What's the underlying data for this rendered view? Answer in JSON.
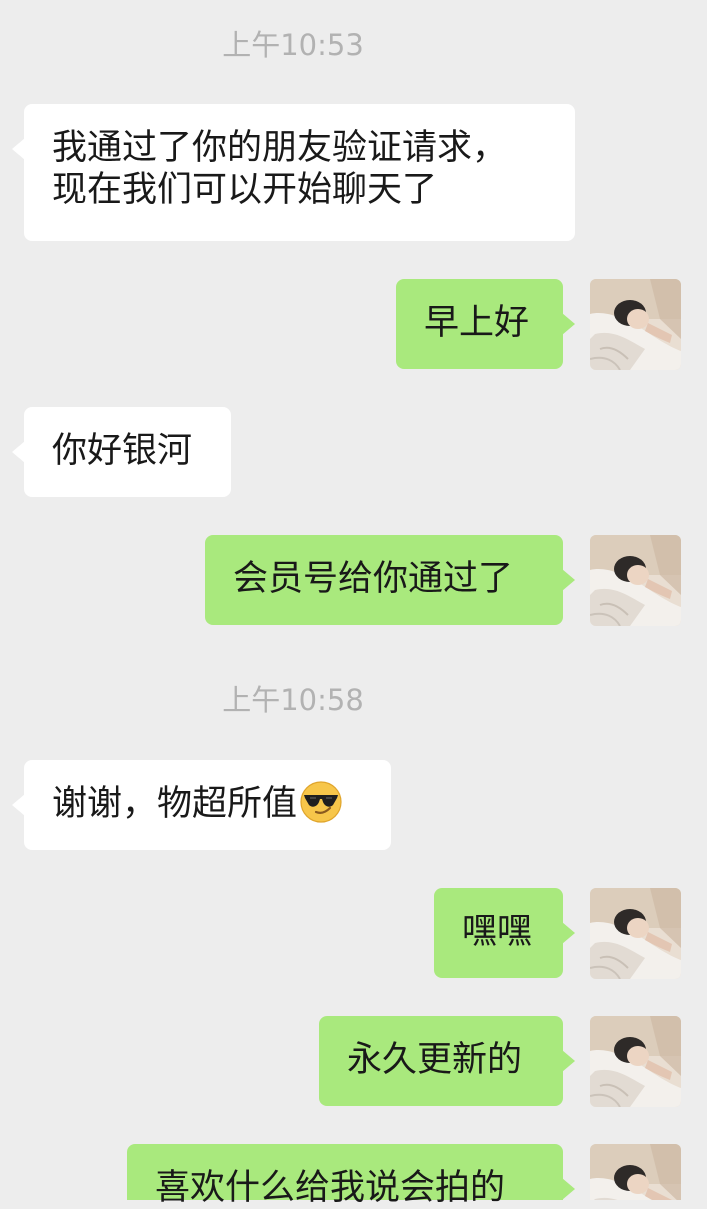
{
  "chat": {
    "messages": [
      {
        "type": "time",
        "text": "上午10:53"
      },
      {
        "type": "in",
        "lines": [
          "我通过了你的朋友验证请求，",
          "现在我们可以开始聊天了"
        ]
      },
      {
        "type": "out",
        "text": "早上好"
      },
      {
        "type": "in",
        "text": "你好银河"
      },
      {
        "type": "out",
        "text": "会员号给你通过了"
      },
      {
        "type": "time",
        "text": "上午10:58"
      },
      {
        "type": "in",
        "text": "谢谢，物超所值",
        "emoji": "smiling-face-with-sunglasses-icon"
      },
      {
        "type": "out",
        "text": "嘿嘿"
      },
      {
        "type": "out",
        "text": "永久更新的"
      },
      {
        "type": "out",
        "text": "喜欢什么给我说会拍的"
      }
    ]
  },
  "colors": {
    "background": "#ededed",
    "incoming_bubble": "#ffffff",
    "outgoing_bubble": "#a9e97d",
    "timestamp_text": "#b2b2b2",
    "message_text": "#191919"
  }
}
